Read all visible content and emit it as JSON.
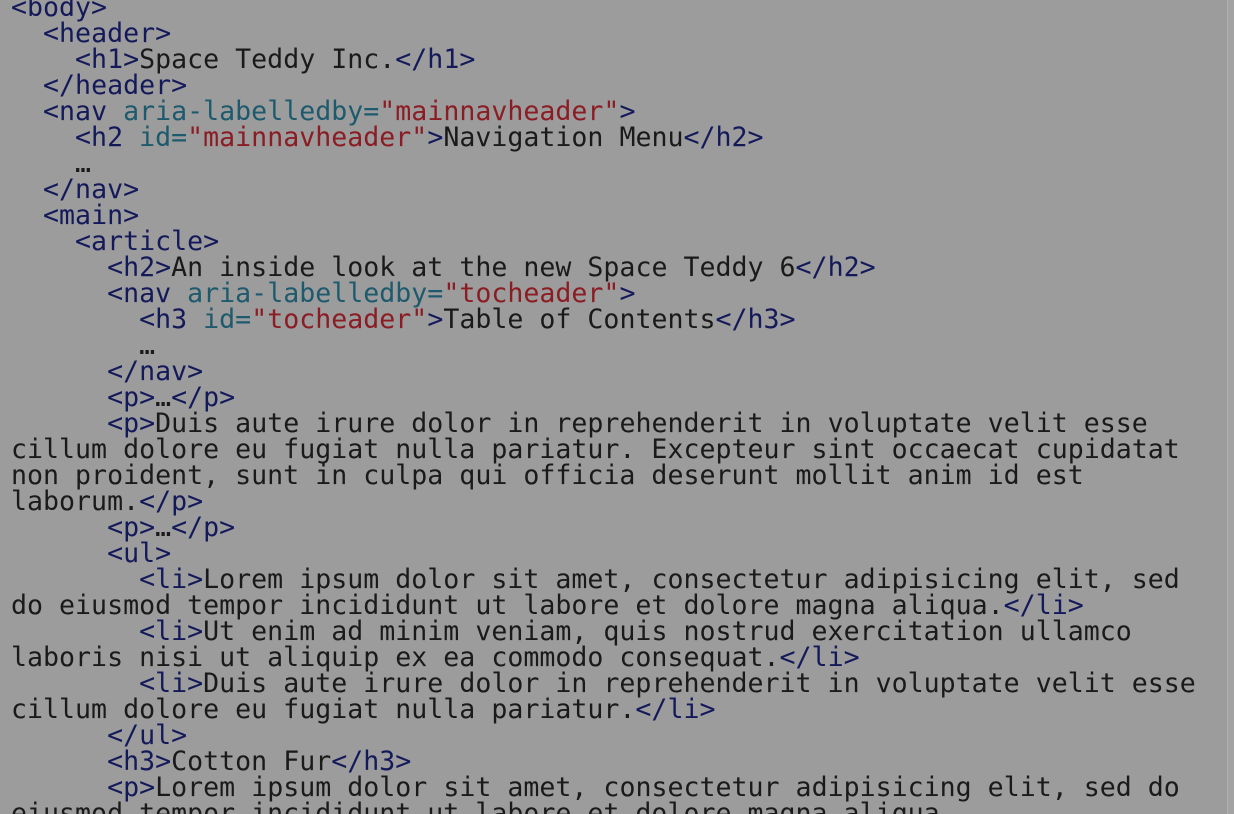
{
  "colors": {
    "background": "#9c9c9c",
    "tag": "#14195a",
    "text": "#1a1a1a",
    "attribute": "#1d5a6d",
    "string": "#8c1c24"
  },
  "lines": [
    [
      [
        "tag",
        "<body>"
      ]
    ],
    [
      [
        "ws",
        "  "
      ],
      [
        "tag",
        "<header>"
      ]
    ],
    [
      [
        "ws",
        "    "
      ],
      [
        "tag",
        "<h1>"
      ],
      [
        "text",
        "Space Teddy Inc."
      ],
      [
        "tag",
        "</h1>"
      ]
    ],
    [
      [
        "ws",
        "  "
      ],
      [
        "tag",
        "</header>"
      ]
    ],
    [
      [
        "ws",
        "  "
      ],
      [
        "tag",
        "<nav "
      ],
      [
        "attr",
        "aria-labelledby="
      ],
      [
        "str",
        "\"mainnavheader\""
      ],
      [
        "tag",
        ">"
      ]
    ],
    [
      [
        "ws",
        "    "
      ],
      [
        "tag",
        "<h2 "
      ],
      [
        "attr",
        "id="
      ],
      [
        "str",
        "\"mainnavheader\""
      ],
      [
        "tag",
        ">"
      ],
      [
        "text",
        "Navigation Menu"
      ],
      [
        "tag",
        "</h2>"
      ]
    ],
    [
      [
        "ws",
        "    "
      ],
      [
        "text",
        "…"
      ]
    ],
    [
      [
        "ws",
        "  "
      ],
      [
        "tag",
        "</nav>"
      ]
    ],
    [
      [
        "ws",
        "  "
      ],
      [
        "tag",
        "<main>"
      ]
    ],
    [
      [
        "ws",
        "    "
      ],
      [
        "tag",
        "<article>"
      ]
    ],
    [
      [
        "ws",
        "      "
      ],
      [
        "tag",
        "<h2>"
      ],
      [
        "text",
        "An inside look at the new Space Teddy 6"
      ],
      [
        "tag",
        "</h2>"
      ]
    ],
    [
      [
        "ws",
        "      "
      ],
      [
        "tag",
        "<nav "
      ],
      [
        "attr",
        "aria-labelledby="
      ],
      [
        "str",
        "\"tocheader\""
      ],
      [
        "tag",
        ">"
      ]
    ],
    [
      [
        "ws",
        "        "
      ],
      [
        "tag",
        "<h3 "
      ],
      [
        "attr",
        "id="
      ],
      [
        "str",
        "\"tocheader\""
      ],
      [
        "tag",
        ">"
      ],
      [
        "text",
        "Table of Contents"
      ],
      [
        "tag",
        "</h3>"
      ]
    ],
    [
      [
        "ws",
        "        "
      ],
      [
        "text",
        "…"
      ]
    ],
    [
      [
        "ws",
        "      "
      ],
      [
        "tag",
        "</nav>"
      ]
    ],
    [
      [
        "ws",
        "      "
      ],
      [
        "tag",
        "<p>"
      ],
      [
        "text",
        "…"
      ],
      [
        "tag",
        "</p>"
      ]
    ],
    [
      [
        "ws",
        "      "
      ],
      [
        "tag",
        "<p>"
      ],
      [
        "text",
        "Duis aute irure dolor in reprehenderit in voluptate velit esse"
      ]
    ],
    [
      [
        "text",
        "cillum dolore eu fugiat nulla pariatur. Excepteur sint occaecat cupidatat"
      ]
    ],
    [
      [
        "text",
        "non proident, sunt in culpa qui officia deserunt mollit anim id est"
      ]
    ],
    [
      [
        "text",
        "laborum."
      ],
      [
        "tag",
        "</p>"
      ]
    ],
    [
      [
        "ws",
        "      "
      ],
      [
        "tag",
        "<p>"
      ],
      [
        "text",
        "…"
      ],
      [
        "tag",
        "</p>"
      ]
    ],
    [
      [
        "ws",
        "      "
      ],
      [
        "tag",
        "<ul>"
      ]
    ],
    [
      [
        "ws",
        "        "
      ],
      [
        "tag",
        "<li>"
      ],
      [
        "text",
        "Lorem ipsum dolor sit amet, consectetur adipisicing elit, sed"
      ]
    ],
    [
      [
        "text",
        "do eiusmod tempor incididunt ut labore et dolore magna aliqua."
      ],
      [
        "tag",
        "</li>"
      ]
    ],
    [
      [
        "ws",
        "        "
      ],
      [
        "tag",
        "<li>"
      ],
      [
        "text",
        "Ut enim ad minim veniam, quis nostrud exercitation ullamco"
      ]
    ],
    [
      [
        "text",
        "laboris nisi ut aliquip ex ea commodo consequat."
      ],
      [
        "tag",
        "</li>"
      ]
    ],
    [
      [
        "ws",
        "        "
      ],
      [
        "tag",
        "<li>"
      ],
      [
        "text",
        "Duis aute irure dolor in reprehenderit in voluptate velit esse"
      ]
    ],
    [
      [
        "text",
        "cillum dolore eu fugiat nulla pariatur."
      ],
      [
        "tag",
        "</li>"
      ]
    ],
    [
      [
        "ws",
        "      "
      ],
      [
        "tag",
        "</ul>"
      ]
    ],
    [
      [
        "ws",
        "      "
      ],
      [
        "tag",
        "<h3>"
      ],
      [
        "text",
        "Cotton Fur"
      ],
      [
        "tag",
        "</h3>"
      ]
    ],
    [
      [
        "ws",
        "      "
      ],
      [
        "tag",
        "<p>"
      ],
      [
        "text",
        "Lorem ipsum dolor sit amet, consectetur adipisicing elit, sed do"
      ]
    ],
    [
      [
        "text",
        "eiusmod tempor incididunt ut labore et dolore magna aliqua."
      ]
    ]
  ]
}
